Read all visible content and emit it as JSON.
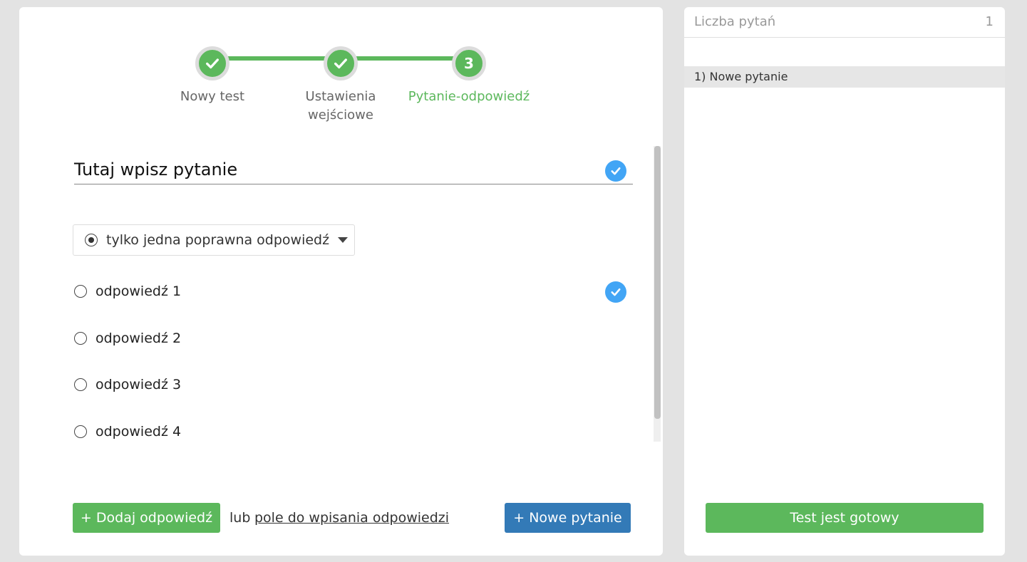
{
  "stepper": {
    "steps": [
      {
        "label": "Nowy test",
        "state": "done"
      },
      {
        "label": "Ustawienia wejściowe",
        "label_line1": "Ustawienia",
        "label_line2": "wejściowe",
        "state": "done"
      },
      {
        "label": "Pytanie-odpowiedź",
        "number": "3",
        "state": "active"
      }
    ],
    "accent_color": "#5cb85c"
  },
  "question": {
    "text": "Tutaj wpisz pytanie"
  },
  "answer_type": {
    "selected": "tylko jedna poprawna odpowiedź"
  },
  "answers": [
    {
      "label": "odpowiedź 1",
      "correct": true
    },
    {
      "label": "odpowiedź 2",
      "correct": false
    },
    {
      "label": "odpowiedź 3",
      "correct": false
    },
    {
      "label": "odpowiedź 4",
      "correct": false
    }
  ],
  "footer": {
    "add_answer_label": "+ Dodaj odpowiedź",
    "or_text": "lub",
    "free_text_link": "pole do wpisania odpowiedzi",
    "new_question_label": "+ Nowe pytanie"
  },
  "sidebar": {
    "header_label": "Liczba pytań",
    "header_count": "1",
    "questions": [
      "1) Nowe pytanie"
    ],
    "finish_label": "Test jest gotowy"
  },
  "colors": {
    "green": "#5cb85c",
    "blue_button": "#337ab7",
    "check_blue": "#42a5f5"
  }
}
